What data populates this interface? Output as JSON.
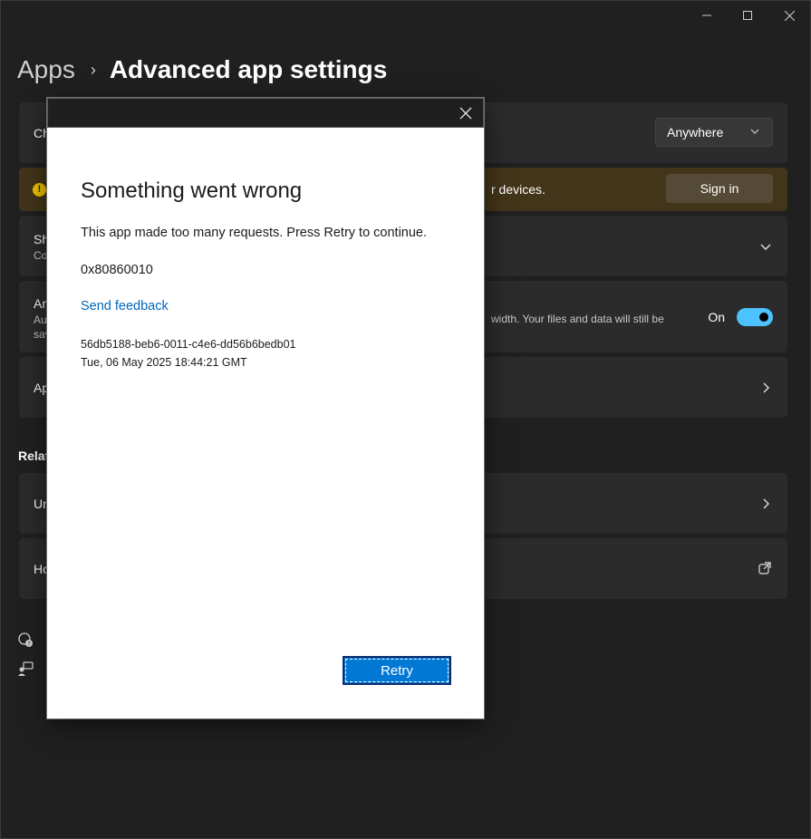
{
  "breadcrumb": {
    "root": "Apps",
    "separator": "›",
    "current": "Advanced app settings"
  },
  "cards": {
    "choose_where": {
      "label": "Ch",
      "dropdown_value": "Anywhere"
    },
    "signin_banner": {
      "text": "r devices.",
      "button": "Sign in"
    },
    "share": {
      "label": "Sh",
      "sub": "Co"
    },
    "archive": {
      "label": "Ar",
      "sub_line1": "Au",
      "sub_line2": "sav",
      "right_text": "width. Your files and data will still be",
      "toggle_label": "On",
      "toggle_state": "on"
    },
    "app_row": {
      "label": "Ap"
    }
  },
  "related": {
    "heading": "Relat",
    "row1_label": "Un",
    "row2_label": "Ho"
  },
  "dialog": {
    "title": "Something went wrong",
    "message": "This app made too many requests. Press Retry to continue.",
    "error_code": "0x80860010",
    "feedback_link": "Send feedback",
    "correlation_id": "56db5188-beb6-0011-c4e6-dd56b6bedb01",
    "timestamp": "Tue, 06 May 2025 18:44:21 GMT",
    "retry_button": "Retry"
  },
  "colors": {
    "accent": "#0078d4",
    "link": "#0067c0",
    "toggle": "#4cc2ff",
    "warning": "#f2c500"
  }
}
